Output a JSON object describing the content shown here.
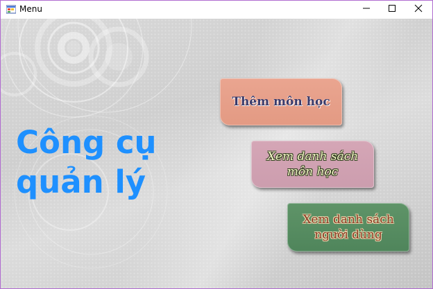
{
  "window": {
    "title": "Menu",
    "controls": {
      "minimize": "minimize-icon",
      "maximize": "maximize-icon",
      "close": "close-icon"
    }
  },
  "main": {
    "headline_line1": "Công cụ",
    "headline_line2": "quản lý",
    "buttons": [
      {
        "label": "Thêm môn học",
        "color": "#e39a83"
      },
      {
        "label_line1": "Xem danh sách",
        "label_line2": "môn học",
        "color": "#cc9dae"
      },
      {
        "label_line1": "Xem danh sách",
        "label_line2": "người dùng",
        "color": "#4f855b"
      }
    ]
  },
  "colors": {
    "headline": "#1e90ff",
    "window_border": "#b06bd0"
  }
}
